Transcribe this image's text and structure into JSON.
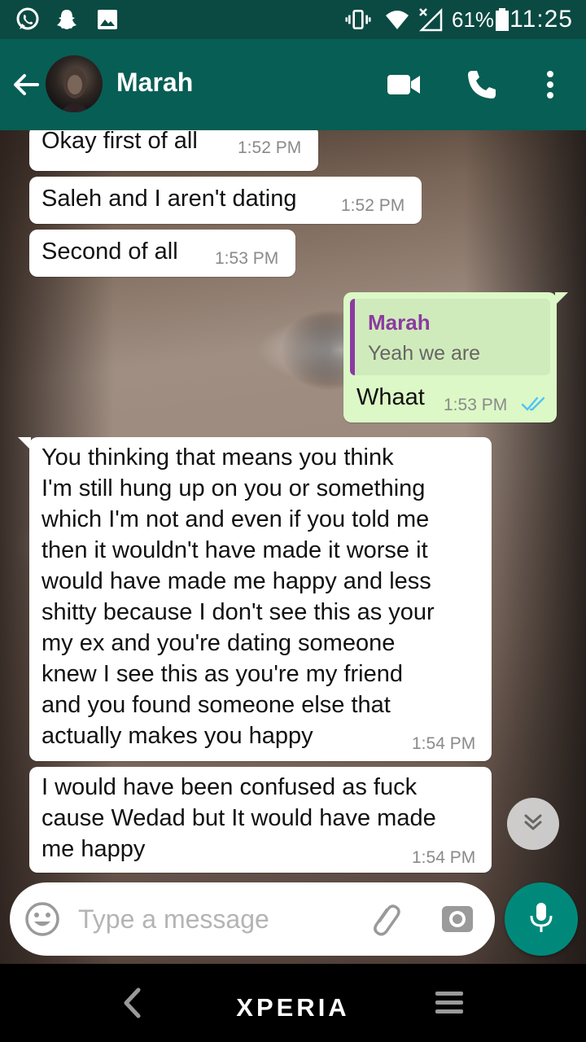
{
  "status_bar": {
    "battery": "61%",
    "time": "11:25",
    "icons": [
      "whatsapp-icon",
      "snapchat-icon",
      "gallery-icon",
      "vibrate-icon",
      "wifi-icon",
      "signal-icon",
      "battery-icon"
    ]
  },
  "header": {
    "contact_name": "Marah",
    "icons": [
      "back-arrow-icon",
      "avatar",
      "video-call-icon",
      "phone-icon",
      "more-options-icon"
    ]
  },
  "messages": [
    {
      "direction": "incoming",
      "text": "Okay first of all",
      "time": "1:52 PM"
    },
    {
      "direction": "incoming",
      "text": "Saleh and I aren't dating",
      "time": "1:52 PM"
    },
    {
      "direction": "incoming",
      "text": "Second of all",
      "time": "1:53 PM"
    },
    {
      "direction": "outgoing",
      "quote_author": "Marah",
      "quote_text": "Yeah we are",
      "text": "Whaat",
      "time": "1:53 PM",
      "status": "read"
    },
    {
      "direction": "incoming",
      "text": "You thinking that means you think\nI'm still hung up on you or something\nwhich I'm not and even if you told me\nthen it wouldn't have made it worse it\nwould have made me happy and less\nshitty because I don't see this as your\nmy ex and you're dating someone\nknew I see this as you're my friend\nand you found someone else that\nactually makes you happy",
      "time": "1:54 PM"
    },
    {
      "direction": "incoming",
      "text": "I would have been confused as fuck\ncause Wedad but It would have made\nme happy",
      "time": "1:54 PM"
    }
  ],
  "composer": {
    "placeholder": "Type a message",
    "icons": [
      "emoji-icon",
      "attach-icon",
      "camera-icon",
      "mic-icon"
    ]
  },
  "nav_bar": {
    "brand": "XPERIA",
    "icons": [
      "nav-back-icon",
      "nav-menu-icon"
    ]
  },
  "colors": {
    "status_bar": "#0a4a42",
    "toolbar": "#075e54",
    "outgoing_bubble": "#dcf8c6",
    "incoming_bubble": "#ffffff",
    "quote_accent": "#8c3aa0",
    "read_ticks": "#4fc3f7",
    "mic_button": "#00897b"
  }
}
